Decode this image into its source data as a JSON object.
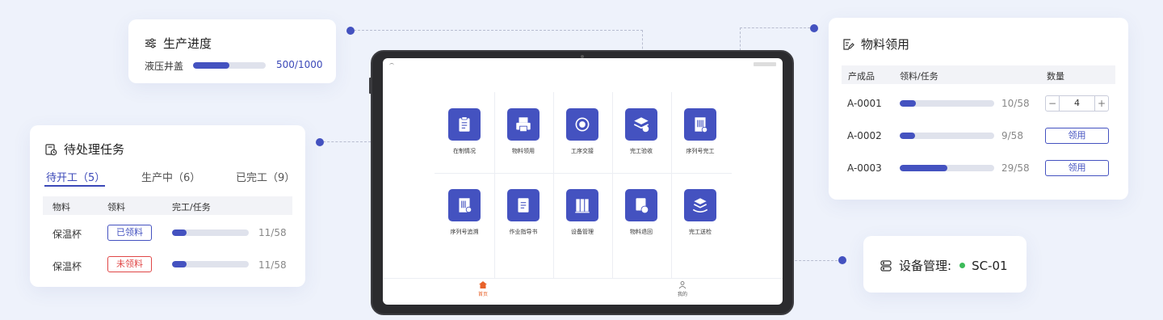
{
  "colors": {
    "accent": "#4452c0",
    "danger": "#e04646",
    "status_online": "#3dbb5a",
    "home_active": "#e8622a"
  },
  "progress": {
    "title": "生产进度",
    "icon": "sliders-icon",
    "item_label": "液压井盖",
    "value_text": "500/1000",
    "fraction": 0.5
  },
  "pending": {
    "title": "待处理任务",
    "icon": "clipboard-clock-icon",
    "tabs": [
      {
        "label": "待开工（5）"
      },
      {
        "label": "生产中（6）"
      },
      {
        "label": "已完工（9）"
      }
    ],
    "headers": [
      "物料",
      "领料",
      "完工/任务"
    ],
    "rows": [
      {
        "material": "保温杯",
        "status": "已领料",
        "progress_text": "11/58",
        "fraction": 0.19
      },
      {
        "material": "保温杯",
        "status": "未领料",
        "progress_text": "11/58",
        "fraction": 0.19
      }
    ]
  },
  "tablet": {
    "apps": [
      {
        "label": "在制情况",
        "icon": "clipboard-icon"
      },
      {
        "label": "物料领用",
        "icon": "printer-icon"
      },
      {
        "label": "工序交接",
        "icon": "refresh-icon"
      },
      {
        "label": "完工验收",
        "icon": "stack-check-icon"
      },
      {
        "label": "序列号完工",
        "icon": "barcode-check-icon"
      },
      {
        "label": "序列号追溯",
        "icon": "barcode-pin-icon"
      },
      {
        "label": "作业指导书",
        "icon": "document-icon"
      },
      {
        "label": "设备管理",
        "icon": "equipment-icon"
      },
      {
        "label": "物料退回",
        "icon": "return-icon"
      },
      {
        "label": "完工送检",
        "icon": "stack-hand-icon"
      }
    ],
    "nav": [
      {
        "label": "首页",
        "icon": "home-icon"
      },
      {
        "label": "我的",
        "icon": "user-icon"
      }
    ]
  },
  "material": {
    "title": "物料领用",
    "icon": "edit-document-icon",
    "headers": [
      "产成品",
      "领料/任务",
      "数量"
    ],
    "rows": [
      {
        "product": "A-0001",
        "progress_text": "10/58",
        "fraction": 0.17,
        "qty": "4",
        "minus": "−",
        "plus": "+"
      },
      {
        "product": "A-0002",
        "progress_text": "9/58",
        "fraction": 0.16,
        "button": "领用"
      },
      {
        "product": "A-0003",
        "progress_text": "29/58",
        "fraction": 0.5,
        "button": "领用"
      }
    ]
  },
  "device": {
    "label": "设备管理:",
    "value": "SC-01",
    "icon": "server-icon"
  }
}
